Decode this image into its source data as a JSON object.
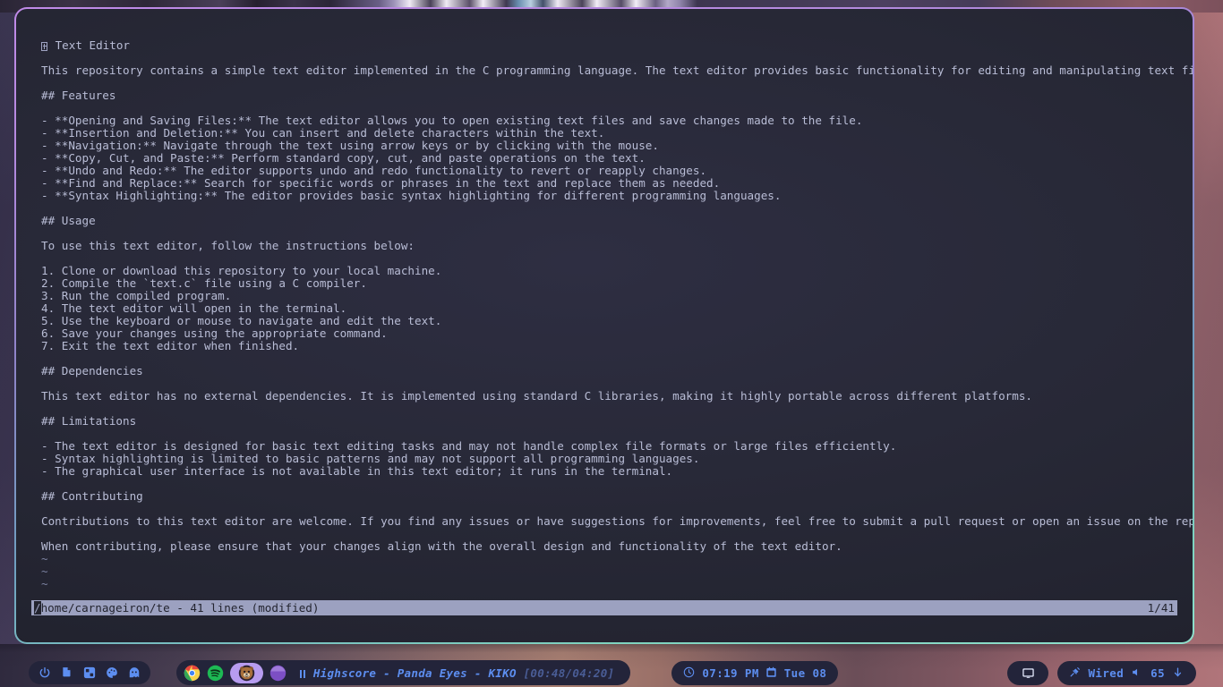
{
  "window": {
    "app": "terminal-text-editor",
    "border_gradient_start": "#c08ae8",
    "border_gradient_end": "#8fe0cc",
    "background": "#272836"
  },
  "editor": {
    "text_color": "#b9bdd6",
    "lines": [
      {
        "type": "heading-tofu",
        "text": " Text Editor"
      },
      {
        "type": "blank",
        "text": ""
      },
      {
        "type": "text",
        "text": "This repository contains a simple text editor implemented in the C programming language. The text editor provides basic functionality for editing and manipulating text files."
      },
      {
        "type": "blank",
        "text": ""
      },
      {
        "type": "text",
        "text": "## Features"
      },
      {
        "type": "blank",
        "text": ""
      },
      {
        "type": "text",
        "text": "- **Opening and Saving Files:** The text editor allows you to open existing text files and save changes made to the file."
      },
      {
        "type": "text",
        "text": "- **Insertion and Deletion:** You can insert and delete characters within the text."
      },
      {
        "type": "text",
        "text": "- **Navigation:** Navigate through the text using arrow keys or by clicking with the mouse."
      },
      {
        "type": "text",
        "text": "- **Copy, Cut, and Paste:** Perform standard copy, cut, and paste operations on the text."
      },
      {
        "type": "text",
        "text": "- **Undo and Redo:** The editor supports undo and redo functionality to revert or reapply changes."
      },
      {
        "type": "text",
        "text": "- **Find and Replace:** Search for specific words or phrases in the text and replace them as needed."
      },
      {
        "type": "text",
        "text": "- **Syntax Highlighting:** The editor provides basic syntax highlighting for different programming languages."
      },
      {
        "type": "blank",
        "text": ""
      },
      {
        "type": "text",
        "text": "## Usage"
      },
      {
        "type": "blank",
        "text": ""
      },
      {
        "type": "text",
        "text": "To use this text editor, follow the instructions below:"
      },
      {
        "type": "blank",
        "text": ""
      },
      {
        "type": "text",
        "text": "1. Clone or download this repository to your local machine."
      },
      {
        "type": "text",
        "text": "2. Compile the `text.c` file using a C compiler."
      },
      {
        "type": "text",
        "text": "3. Run the compiled program."
      },
      {
        "type": "text",
        "text": "4. The text editor will open in the terminal."
      },
      {
        "type": "text",
        "text": "5. Use the keyboard or mouse to navigate and edit the text."
      },
      {
        "type": "text",
        "text": "6. Save your changes using the appropriate command."
      },
      {
        "type": "text",
        "text": "7. Exit the text editor when finished."
      },
      {
        "type": "blank",
        "text": ""
      },
      {
        "type": "text",
        "text": "## Dependencies"
      },
      {
        "type": "blank",
        "text": ""
      },
      {
        "type": "text",
        "text": "This text editor has no external dependencies. It is implemented using standard C libraries, making it highly portable across different platforms."
      },
      {
        "type": "blank",
        "text": ""
      },
      {
        "type": "text",
        "text": "## Limitations"
      },
      {
        "type": "blank",
        "text": ""
      },
      {
        "type": "text",
        "text": "- The text editor is designed for basic text editing tasks and may not handle complex file formats or large files efficiently."
      },
      {
        "type": "text",
        "text": "- Syntax highlighting is limited to basic patterns and may not support all programming languages."
      },
      {
        "type": "text",
        "text": "- The graphical user interface is not available in this text editor; it runs in the terminal."
      },
      {
        "type": "blank",
        "text": ""
      },
      {
        "type": "text",
        "text": "## Contributing"
      },
      {
        "type": "blank",
        "text": ""
      },
      {
        "type": "text",
        "text": "Contributions to this text editor are welcome. If you find any issues or have suggestions for improvements, feel free to submit a pull request or open an issue on the repository."
      },
      {
        "type": "blank",
        "text": ""
      },
      {
        "type": "text",
        "text": "When contributing, please ensure that your changes align with the overall design and functionality of the text editor."
      },
      {
        "type": "tilde",
        "text": "~"
      },
      {
        "type": "tilde",
        "text": "~"
      },
      {
        "type": "tilde",
        "text": "~"
      }
    ]
  },
  "statusline": {
    "filename_cursor": "/",
    "left": "home/carnageiron/te - 41 lines (modified)",
    "right": "1/41",
    "background": "#9ca1c0",
    "foreground": "#23242f"
  },
  "taskbar": {
    "tray": [
      {
        "name": "power-icon",
        "label": "Power"
      },
      {
        "name": "files-icon",
        "label": "Files"
      },
      {
        "name": "apps-grid-icon",
        "label": "Apps"
      },
      {
        "name": "palette-icon",
        "label": "Theme"
      },
      {
        "name": "ghost-icon",
        "label": "Ghost"
      }
    ],
    "launcher": [
      {
        "name": "chrome-icon",
        "label": "Google Chrome",
        "active": false
      },
      {
        "name": "spotify-icon",
        "label": "Spotify",
        "active": false
      },
      {
        "name": "bear-app-icon",
        "label": "Terminal",
        "active": true
      },
      {
        "name": "purple-app-icon",
        "label": "App",
        "active": false
      }
    ],
    "media": {
      "state": "paused",
      "title": "Highscore - Panda Eyes - KIKO",
      "elapsed": "00:48",
      "duration": "04:20",
      "time_display": "[00:48/04:20]"
    },
    "clock": {
      "time": "07:19 PM",
      "date": "Tue 08"
    },
    "layout": {
      "name": "monitor-icon",
      "label": ""
    },
    "system": {
      "network": "Wired",
      "volume": "65",
      "accent": "#5d8ef0"
    }
  }
}
